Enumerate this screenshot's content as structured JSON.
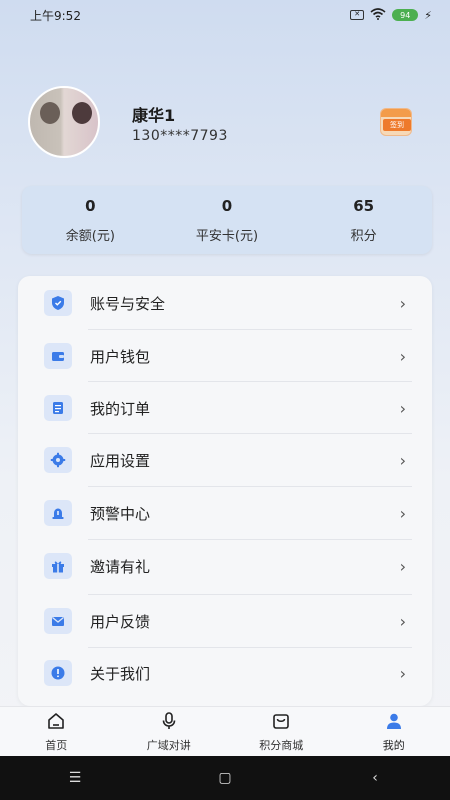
{
  "status_bar": {
    "time": "上午9:52",
    "battery": "94"
  },
  "profile": {
    "name": "康华1",
    "phone": "130****7793",
    "signin_label": "签到"
  },
  "stats": [
    {
      "value": "0",
      "label": "余额(元)"
    },
    {
      "value": "0",
      "label": "平安卡(元)"
    },
    {
      "value": "65",
      "label": "积分"
    }
  ],
  "menu": [
    {
      "label": "账号与安全",
      "icon": "shield-icon"
    },
    {
      "label": "用户钱包",
      "icon": "wallet-icon"
    },
    {
      "label": "我的订单",
      "icon": "order-icon"
    },
    {
      "label": "应用设置",
      "icon": "gear-icon"
    },
    {
      "label": "预警中心",
      "icon": "alert-icon"
    },
    {
      "label": "邀请有礼",
      "icon": "gift-icon"
    },
    {
      "label": "用户反馈",
      "icon": "mail-icon"
    },
    {
      "label": "关于我们",
      "icon": "info-icon"
    }
  ],
  "tabs": [
    {
      "label": "首页",
      "icon": "home-icon"
    },
    {
      "label": "广域对讲",
      "icon": "microphone-icon"
    },
    {
      "label": "积分商城",
      "icon": "shopping-bag-icon"
    },
    {
      "label": "我的",
      "icon": "user-icon"
    }
  ],
  "colors": {
    "accent": "#3b7be8",
    "icon_bg": "#dce6f8"
  }
}
